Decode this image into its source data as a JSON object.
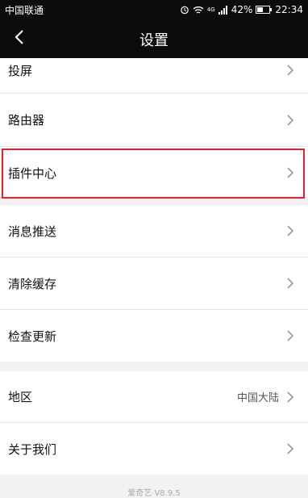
{
  "status_bar": {
    "carrier": "中国联通",
    "signal_label": "4G",
    "battery": "42%",
    "time": "22:34"
  },
  "header": {
    "title": "设置",
    "back_icon": "chevron-left-icon"
  },
  "settings": {
    "items": [
      {
        "label": "投屏"
      },
      {
        "label": "路由器"
      },
      {
        "label": "插件中心"
      },
      {
        "label": "消息推送"
      },
      {
        "label": "清除缓存"
      },
      {
        "label": "检查更新"
      },
      {
        "label": "地区",
        "value": "中国大陆"
      },
      {
        "label": "关于我们"
      }
    ]
  },
  "footer": {
    "version": "爱奇艺 V8.9.5"
  },
  "colors": {
    "bar_bg": "#0c0c0c",
    "page_bg": "#f2f2f2",
    "highlight": "#e8202e"
  }
}
